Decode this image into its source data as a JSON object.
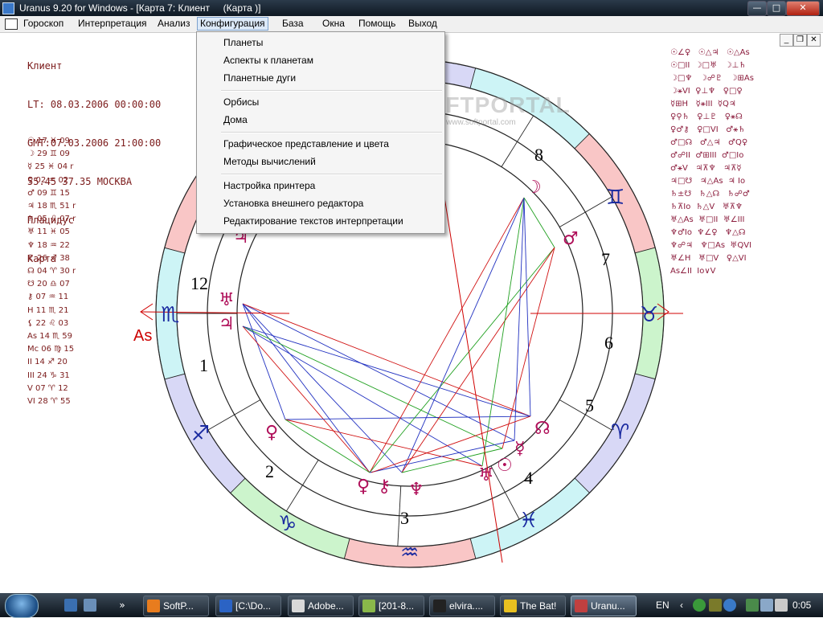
{
  "window": {
    "title": "Uranus 9.20 for Windows - [Карта 7: Клиент     (Карта )]",
    "buttons": {
      "minimize": "—",
      "maximize": "□",
      "close": "✕"
    }
  },
  "menubar": {
    "items": [
      "Гороскоп",
      "Интерпретация",
      "Анализ",
      "Конфигурация",
      "База",
      "Окна",
      "Помощь",
      "Выход"
    ],
    "active": "Конфигурация",
    "mdi_buttons": {
      "minimize": "_",
      "restore": "❐",
      "close": "✕"
    }
  },
  "dropdown": {
    "groups": [
      [
        "Планеты",
        "Аспекты к планетам",
        "Планетные дуги"
      ],
      [
        "Орбисы",
        "Дома"
      ],
      [
        "Графическое представление и цвета",
        "Методы вычислений"
      ],
      [
        "Настройка принтера",
        "Установка внешнего редактора",
        "Редактирование текстов интерпретации"
      ]
    ]
  },
  "chart_info": {
    "lines": [
      "Клиент",
      "LT: 08.03.2006 00:00:00",
      "GMT:07.03.2006 21:00:00",
      "55.45 37.35 МОСКВА",
      "Плацидус",
      "Карта"
    ]
  },
  "planet_positions": [
    "☉ 17 ♓ 09",
    "☽ 29 ♊ 09",
    "☿ 25 ♓ 04 r",
    "♀ 02 ♒ 02",
    "♂ 09 ♊ 15",
    "♃ 18 ♏ 51 r",
    "♄ 05 ♌ 07 r",
    "♅ 11 ♓ 05",
    "♆ 18 ♒ 22",
    "♇ 26 ♐ 38",
    "☊ 04 ♈ 30 r",
    "☋ 20 ♎ 07",
    "⚷ 07 ♒ 11",
    "H 11 ♏ 21",
    "⚸ 22 ♌ 03",
    "As 14 ♏ 59",
    "Mc 06 ♍ 15",
    "II 14 ♐ 20",
    "III 24 ♑ 31",
    "V 07 ♈ 12",
    "VI 28 ♈ 55"
  ],
  "aspects": [
    "☉∠♀   ☉△♃   ☉△As",
    "☉□II  ☽□♅   ☽⊥♄",
    "☽□♆   ☽☍♇   ☽⊞As",
    "☽⚹VI  ♀⊥♆   ♀□♀",
    "☿⊞H   ☿⚹III  ☿Q♃",
    "♀⚲♄   ♀⊥♇   ♀⚹☊",
    "♀♂⚷   ♀□VI   ♂⚹♄",
    "♂□☊   ♂△♃   ♂Q♀",
    "♂☍II  ♂⊞III  ♂□Io",
    "♂⚹V   ♃⊼♆   ♃⊼☿",
    "♃□☋   ♃△As  ♃ Io",
    "♄±☋   ♄△☊   ♄☍♂",
    "♄⊼Io  ♄△V   ♅⊼♆",
    "♅△As  ♅□II  ♅∠III",
    "♆♂Io  ♆∠♀   ♆△☊",
    "♆☍♃   ♆□As  ♅QVI",
    "♅∠H   ♅□V   ♀△VI",
    "As∠II  Io∨V"
  ],
  "wheel": {
    "house_numbers": [
      "1",
      "2",
      "3",
      "4",
      "5",
      "6",
      "7",
      "8",
      "12"
    ],
    "asc_label": "As",
    "sign_labels": [
      "♏",
      "♐",
      "♑",
      "♒",
      "♓",
      "♈",
      "♉",
      "♊"
    ],
    "planet_glyphs": [
      "♅",
      "♃",
      "♀",
      "☊",
      "☿",
      "☉",
      "♅",
      "♆",
      "♀",
      "⚷",
      "♂",
      "☽",
      "♃"
    ]
  },
  "watermark": {
    "text": "SOFTPORTAL",
    "sub": "www.softportal.com"
  },
  "taskbar": {
    "tasks": [
      "SoftP...",
      "[C:\\Do...",
      "Adobe...",
      "[201-8...",
      "elvira....",
      "The Bat!",
      "Uranu..."
    ],
    "active_task": "Uranu...",
    "lang": "EN",
    "clock": "0:05"
  }
}
